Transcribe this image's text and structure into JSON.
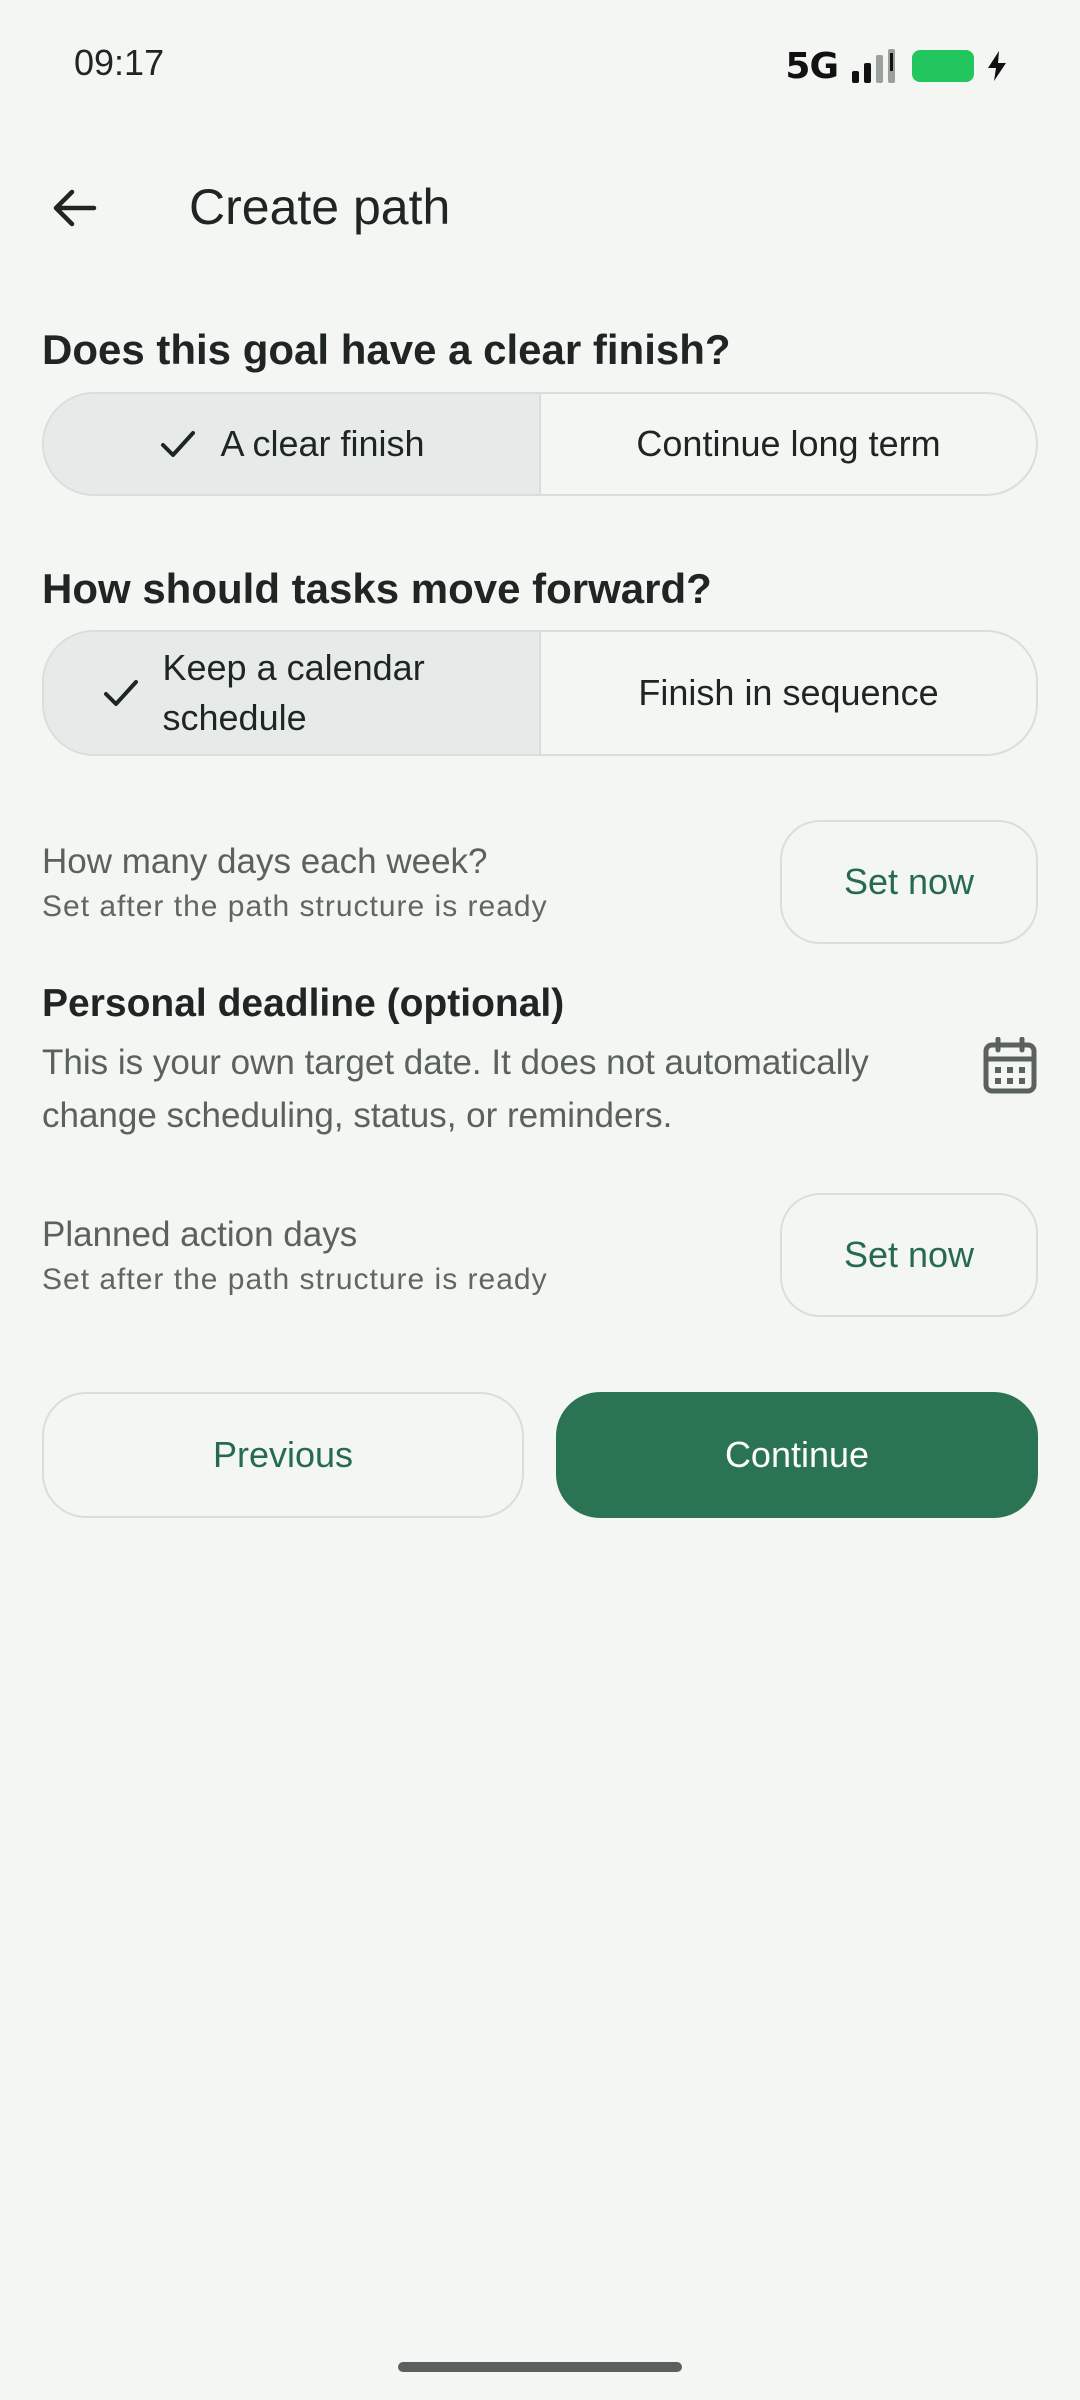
{
  "status_bar": {
    "time": "09:17",
    "network": "5G",
    "signal_icon": "signal-icon",
    "battery_icon": "battery-charging-icon",
    "battery_color": "#22c55e"
  },
  "app_bar": {
    "back_icon": "arrow-left-icon",
    "title": "Create path"
  },
  "finish_question": {
    "heading": "Does this goal have a clear finish?",
    "options": [
      {
        "label": "A clear finish",
        "selected": true
      },
      {
        "label": "Continue long term",
        "selected": false
      }
    ]
  },
  "tasks_question": {
    "heading": "How should tasks move forward?",
    "options": [
      {
        "label": "Keep a calendar schedule",
        "selected": true
      },
      {
        "label": "Finish in sequence",
        "selected": false
      }
    ]
  },
  "days_per_week": {
    "title": "How many days each week?",
    "subtitle": "Set after the path structure is ready",
    "button": "Set now"
  },
  "deadline": {
    "title": "Personal deadline (optional)",
    "description": "This is your own target date. It does not automatically change scheduling, status, or reminders.",
    "icon": "calendar-icon"
  },
  "action_days": {
    "title": "Planned action days",
    "subtitle": "Set after the path structure is ready",
    "button": "Set now"
  },
  "footer": {
    "previous": "Previous",
    "continue": "Continue"
  },
  "colors": {
    "accent": "#2a7353",
    "accent_text": "#266b4e",
    "background": "#f4f6f3",
    "selected_segment": "#e6ebea"
  }
}
